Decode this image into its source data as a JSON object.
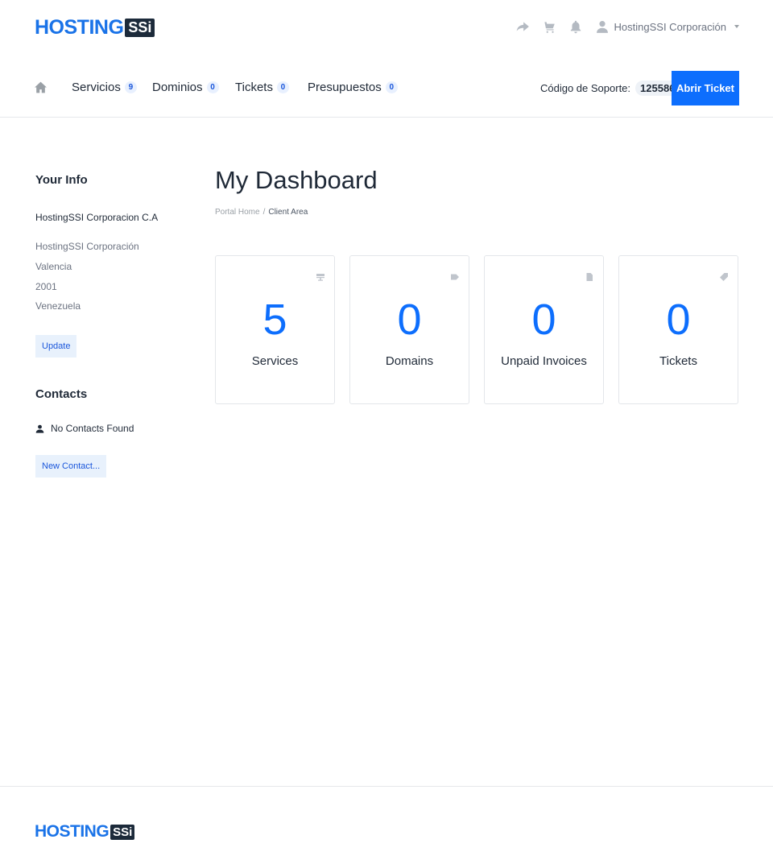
{
  "brand": {
    "word": "HOSTING",
    "box": "SSi"
  },
  "header": {
    "user_name": "HostingSSI Corporación",
    "icons": [
      "share-icon",
      "cart-icon",
      "bell-icon",
      "user-icon"
    ]
  },
  "nav": {
    "items": [
      {
        "label": "Servicios",
        "count": "9"
      },
      {
        "label": "Dominios",
        "count": "0"
      },
      {
        "label": "Tickets",
        "count": "0"
      },
      {
        "label": "Presupuestos",
        "count": "0"
      }
    ],
    "support_label": "Código de Soporte:",
    "support_code": "125586",
    "open_ticket": "Abrir Ticket"
  },
  "sidebar": {
    "info_title": "Your Info",
    "company": "HostingSSI Corporacion C.A",
    "address": [
      "HostingSSI Corporación",
      "Valencia",
      "2001",
      "Venezuela"
    ],
    "update_label": "Update",
    "contacts_title": "Contacts",
    "no_contacts": "No Contacts Found",
    "new_contact_label": "New Contact..."
  },
  "main": {
    "title": "My Dashboard",
    "breadcrumb": {
      "home": "Portal Home",
      "sep": "/",
      "current": "Client Area"
    },
    "tiles": [
      {
        "count": "5",
        "label": "Services",
        "icon": "server-icon"
      },
      {
        "count": "0",
        "label": "Domains",
        "icon": "tag-icon"
      },
      {
        "count": "0",
        "label": "Unpaid Invoices",
        "icon": "document-icon"
      },
      {
        "count": "0",
        "label": "Tickets",
        "icon": "ticket-icon"
      }
    ]
  },
  "colors": {
    "accent": "#0d6efd",
    "brand_blue": "#1a73e8",
    "brand_dark": "#1c2a3a"
  }
}
